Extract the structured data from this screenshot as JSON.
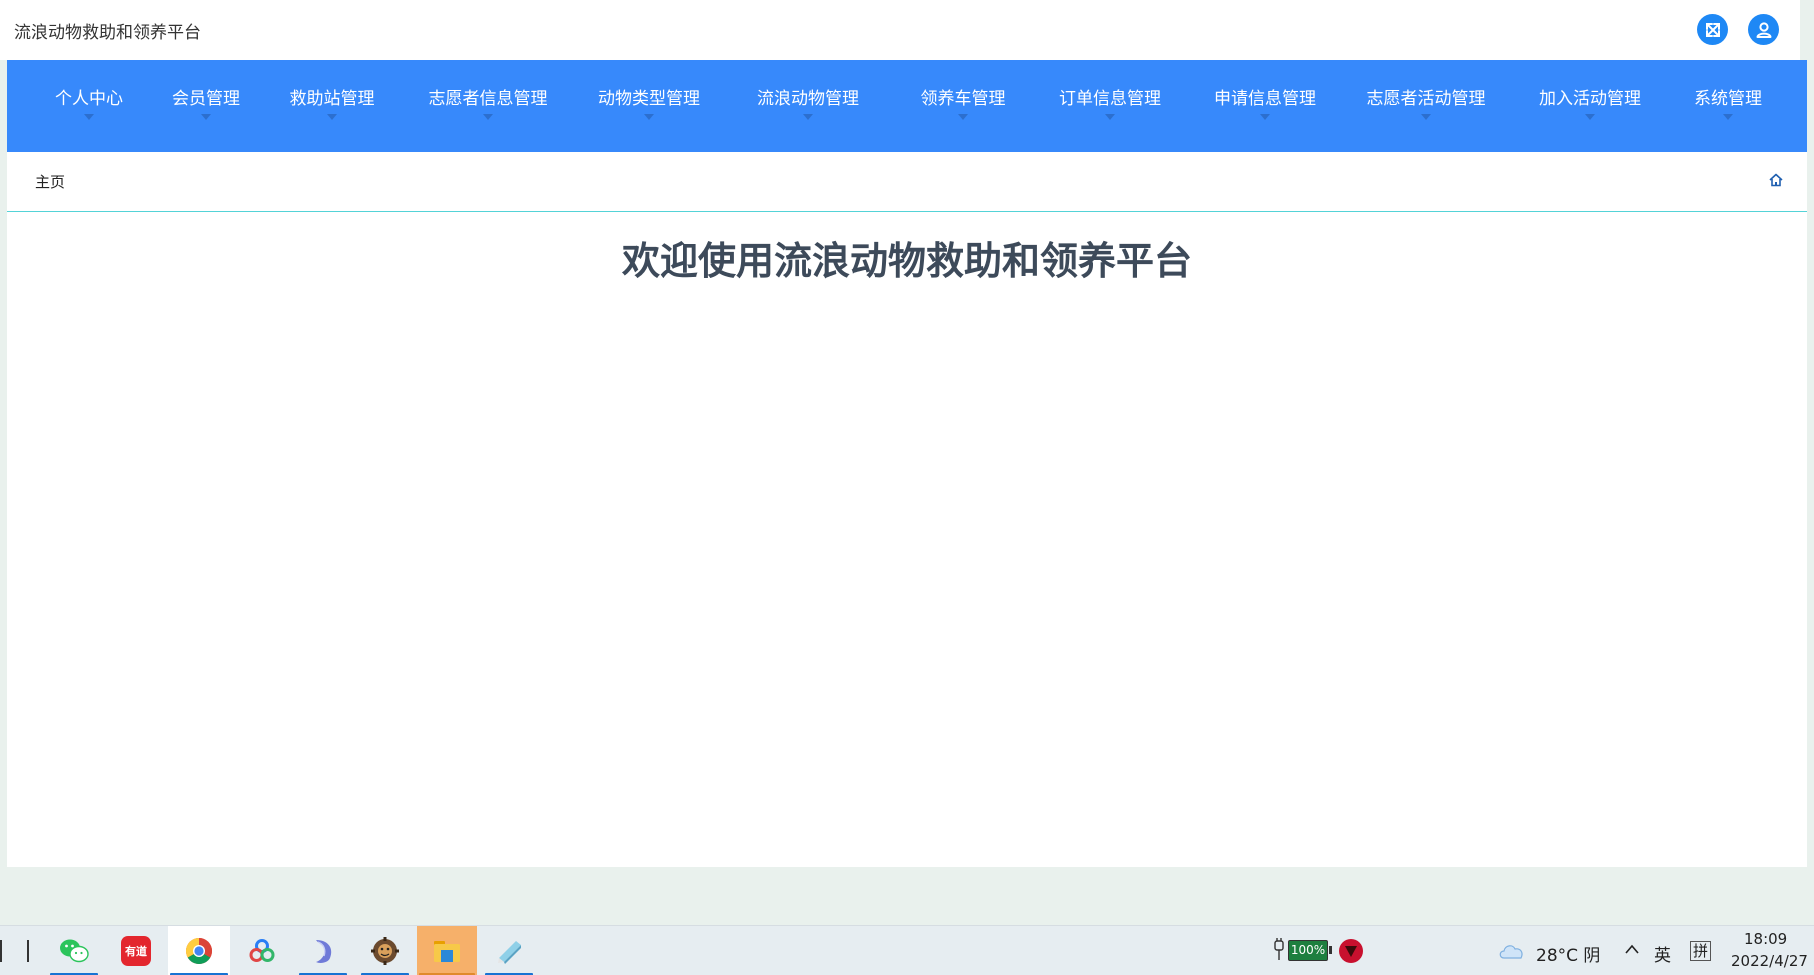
{
  "header": {
    "title": "流浪动物救助和领养平台",
    "icons": [
      "fullscreen-icon",
      "user-icon"
    ],
    "accent_color": "#1e88f5"
  },
  "nav": {
    "background_color": "#3789fb",
    "items": [
      {
        "label": "个人中心"
      },
      {
        "label": "会员管理"
      },
      {
        "label": "救助站管理"
      },
      {
        "label": "志愿者信息管理"
      },
      {
        "label": "动物类型管理"
      },
      {
        "label": "流浪动物管理"
      },
      {
        "label": "领养车管理"
      },
      {
        "label": "订单信息管理"
      },
      {
        "label": "申请信息管理"
      },
      {
        "label": "志愿者活动管理"
      },
      {
        "label": "加入活动管理"
      },
      {
        "label": "系统管理"
      }
    ]
  },
  "breadcrumb": {
    "home": "主页",
    "icon": "home-icon"
  },
  "main": {
    "welcome": "欢迎使用流浪动物救助和领养平台"
  },
  "taskbar": {
    "apps": [
      "wechat-icon",
      "youdao-icon",
      "chrome-icon",
      "baidu-netdisk-icon",
      "dolphin-icon",
      "gear-app-icon",
      "file-explorer-icon",
      "notepad-icon"
    ],
    "youdao_label": "有道",
    "battery": "100%",
    "weather": "28°C  阴",
    "ime_lang": "英",
    "ime_mode": "拼",
    "time": "18:09",
    "date": "2022/4/27"
  }
}
